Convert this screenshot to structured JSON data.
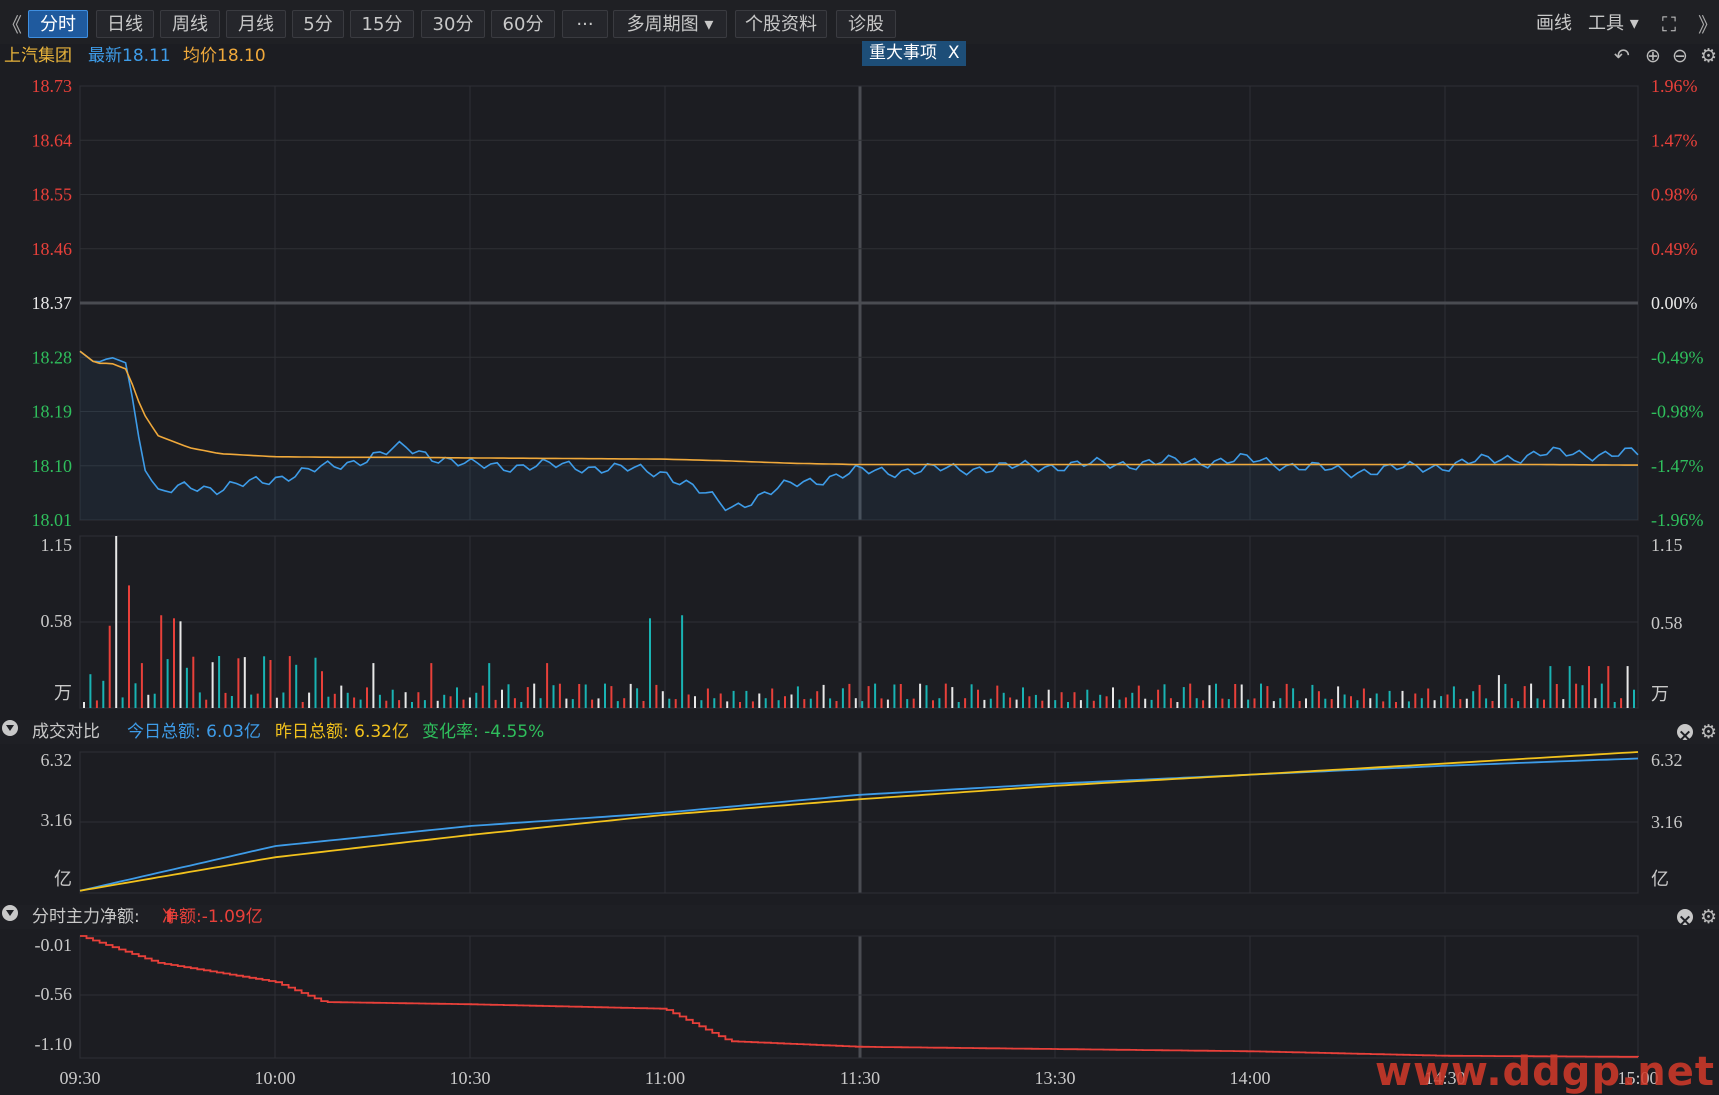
{
  "toolbar": {
    "collapse_glyph": "《",
    "expand_glyph": "》",
    "tabs": [
      {
        "label": "分时",
        "active": true
      },
      {
        "label": "日线"
      },
      {
        "label": "周线"
      },
      {
        "label": "月线"
      },
      {
        "label": "5分"
      },
      {
        "label": "15分"
      },
      {
        "label": "30分"
      },
      {
        "label": "60分"
      },
      {
        "label": "···"
      },
      {
        "label": "多周期图 ▾"
      },
      {
        "label": "个股资料"
      },
      {
        "label": "诊股"
      }
    ],
    "draw_label": "画线",
    "tools_label": "工具 ▾",
    "fullscreen_icon": "fullscreen-icon"
  },
  "info": {
    "stock_name": "上汽集团",
    "latest": "最新18.11",
    "avg": "均价18.10",
    "event_badge": "重大事项",
    "event_close": "X"
  },
  "colors": {
    "up": "#e8403a",
    "down": "#2fbf5c",
    "price_line": "#3e9ce8",
    "avg_line": "#f0a93b",
    "yesterday_line": "#f2c21d",
    "today_line": "#3e9ce8",
    "net_line": "#e8403a"
  },
  "price_panel": {
    "y_left_labels": [
      "18.73",
      "18.64",
      "18.55",
      "18.46",
      "18.37",
      "18.28",
      "18.19",
      "18.10",
      "18.01"
    ],
    "y_right_labels": [
      "1.96%",
      "1.47%",
      "0.98%",
      "0.49%",
      "0.00%",
      "-0.49%",
      "-0.98%",
      "-1.47%",
      "-1.96%"
    ]
  },
  "volume_panel": {
    "y_labels": [
      "1.15",
      "0.58",
      "万"
    ]
  },
  "compare_panel": {
    "title": "成交对比",
    "today_total": "今日总额: 6.03亿",
    "yesterday_total": "昨日总额: 6.32亿",
    "change_rate": "变化率: -4.55%",
    "y_labels": [
      "6.32",
      "3.16",
      "亿"
    ]
  },
  "net_panel": {
    "title": "分时主力净额:",
    "net_value": "净额:-1.09亿",
    "y_labels": [
      "-0.01",
      "-0.56",
      "-1.10"
    ]
  },
  "x_labels": [
    "09:30",
    "10:00",
    "10:30",
    "11:00",
    "11:30",
    "13:30",
    "14:00",
    "14:30",
    "15:00"
  ],
  "watermark": "www.ddgp.net",
  "chart_data": [
    {
      "type": "line",
      "title": "上汽集团 分时",
      "x": [
        "09:30",
        "09:33",
        "09:36",
        "09:39",
        "09:42",
        "09:45",
        "09:50",
        "09:55",
        "10:00",
        "10:10",
        "10:20",
        "10:30",
        "10:45",
        "11:00",
        "11:10",
        "11:20",
        "11:30",
        "13:30",
        "14:00",
        "14:15",
        "14:30",
        "14:45",
        "15:00"
      ],
      "series": [
        {
          "name": "最新",
          "values": [
            18.29,
            18.27,
            18.28,
            18.27,
            18.11,
            18.05,
            18.07,
            18.06,
            18.08,
            18.1,
            18.13,
            18.1,
            18.1,
            18.09,
            18.03,
            18.07,
            18.09,
            18.1,
            18.11,
            18.09,
            18.1,
            18.12,
            18.12
          ]
        },
        {
          "name": "均价",
          "values": [
            18.29,
            18.27,
            18.27,
            18.26,
            18.19,
            18.15,
            18.13,
            18.12,
            18.115,
            18.114,
            18.114,
            18.113,
            18.112,
            18.111,
            18.108,
            18.104,
            18.102,
            18.102,
            18.102,
            18.102,
            18.102,
            18.102,
            18.101
          ]
        }
      ],
      "ylim": [
        18.01,
        18.73
      ],
      "reference_price": 18.37,
      "pct_ylim": [
        -1.96,
        1.96
      ]
    },
    {
      "type": "bar",
      "title": "成交量",
      "ylim": [
        0,
        1.15
      ],
      "ylabel": "万"
    },
    {
      "type": "line",
      "title": "成交对比",
      "x": [
        "09:30",
        "10:00",
        "10:30",
        "11:00",
        "11:30",
        "13:30",
        "14:00",
        "14:30",
        "15:00"
      ],
      "series": [
        {
          "name": "今日总额",
          "values": [
            0.1,
            2.1,
            3.0,
            3.6,
            4.4,
            4.9,
            5.3,
            5.7,
            6.03
          ]
        },
        {
          "name": "昨日总额",
          "values": [
            0.1,
            1.6,
            2.6,
            3.5,
            4.2,
            4.8,
            5.3,
            5.8,
            6.32
          ]
        }
      ],
      "ylim": [
        0,
        6.32
      ],
      "ylabel": "亿"
    },
    {
      "type": "line",
      "title": "分时主力净额",
      "x": [
        "09:30",
        "09:45",
        "10:00",
        "10:15",
        "10:30",
        "10:45",
        "11:00",
        "11:10",
        "11:30",
        "13:30",
        "14:00",
        "14:30",
        "15:00"
      ],
      "series": [
        {
          "name": "净额",
          "values": [
            -0.01,
            -0.25,
            -0.42,
            -0.6,
            -0.62,
            -0.64,
            -0.66,
            -0.95,
            -1.0,
            -1.02,
            -1.04,
            -1.08,
            -1.09
          ]
        }
      ],
      "ylim": [
        -1.1,
        -0.01
      ]
    }
  ]
}
